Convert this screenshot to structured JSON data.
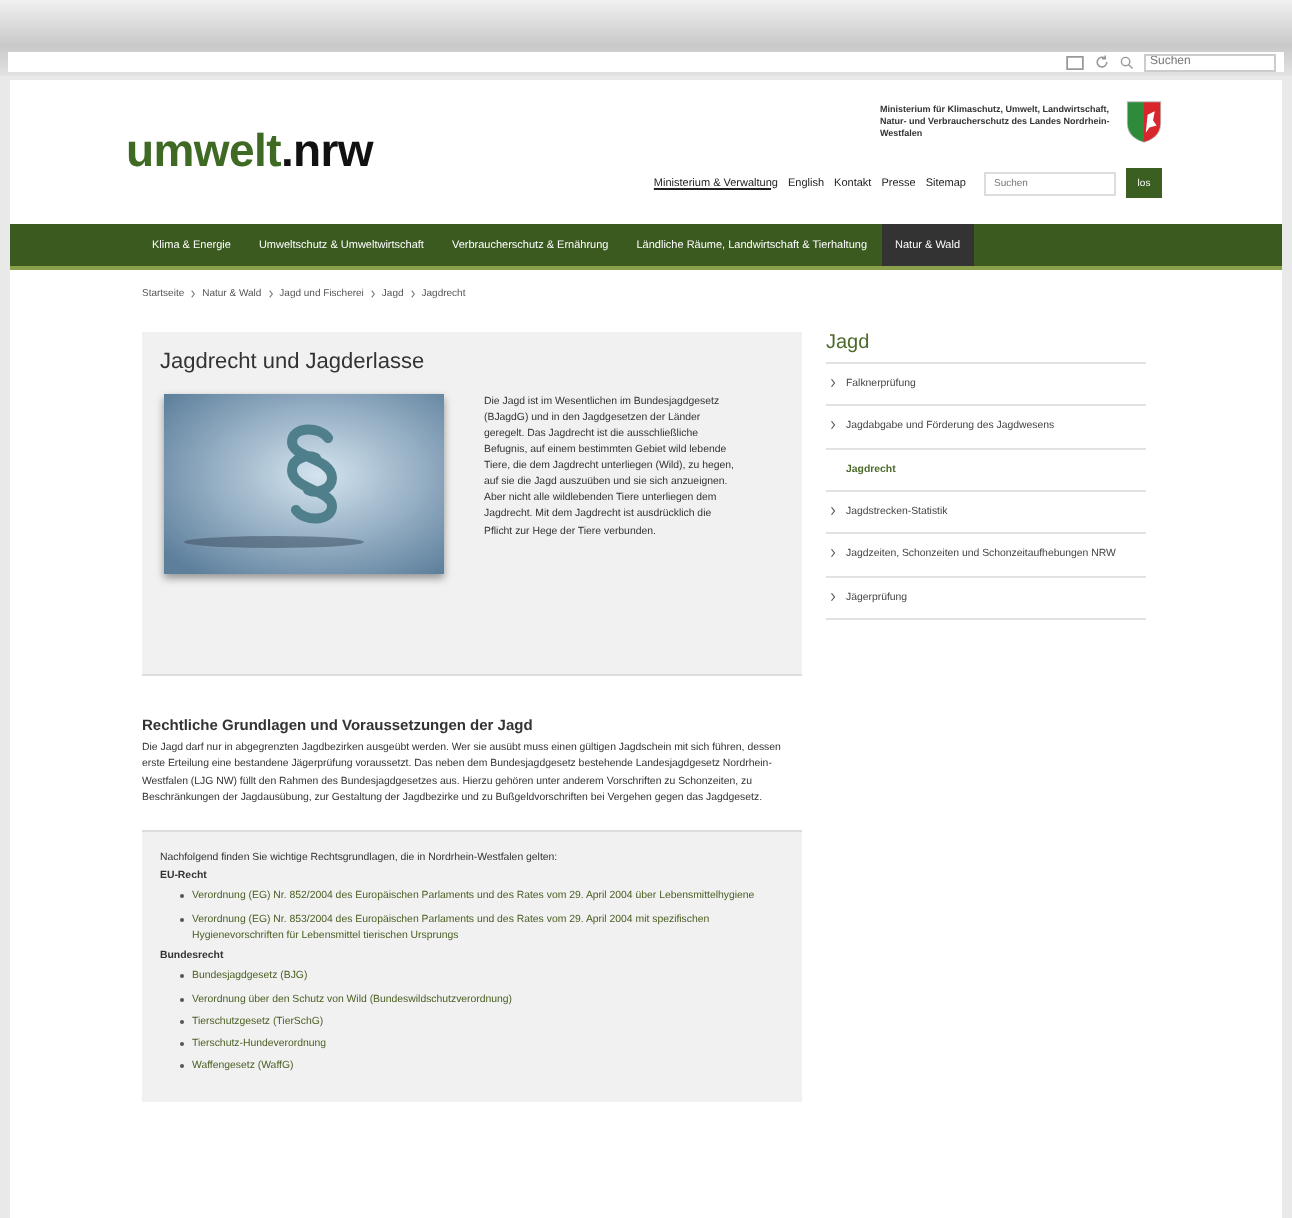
{
  "browser": {
    "search_placeholder": "Suchen"
  },
  "header": {
    "logo_main": "umwelt",
    "logo_suffix": ".nrw",
    "ministry": "Ministerium für Klimaschutz, Umwelt, Landwirtschaft, Natur- und Verbraucherschutz des Landes Nordrhein-Westfalen",
    "links": [
      {
        "label": "Ministerium & Verwaltung",
        "underlined": true
      },
      {
        "label": "English",
        "underlined": false
      },
      {
        "label": "Kontakt",
        "underlined": false
      },
      {
        "label": "Presse",
        "underlined": false
      },
      {
        "label": "Sitemap",
        "underlined": false
      }
    ],
    "search": {
      "placeholder": "Suchen",
      "button": "los"
    }
  },
  "nav": [
    {
      "label": "Klima & Energie",
      "selected": false
    },
    {
      "label": "Umweltschutz & Umweltwirtschaft",
      "selected": false
    },
    {
      "label": "Verbraucherschutz & Ernährung",
      "selected": false
    },
    {
      "label": "Ländliche Räume, Landwirtschaft & Tierhaltung",
      "selected": false
    },
    {
      "label": "Natur & Wald",
      "selected": true
    }
  ],
  "breadcrumb": [
    "Startseite",
    "Natur & Wald",
    "Jagd und Fischerei",
    "Jagd",
    "Jagdrecht"
  ],
  "teaser": {
    "title": "Jagdrecht und Jagderlasse",
    "text": "Die Jagd ist im Wesentlichen im Bundesjagdgesetz (BJagdG) und in den Jagdgesetzen der Länder geregelt. Das Jagdrecht ist die ausschließliche Befugnis, auf einem bestimmten Gebiet wild lebende Tiere, die dem Jagdrecht unterliegen (Wild), zu hegen, auf sie die Jagd auszuüben und sie sich anzueignen. Aber nicht alle wildlebenden Tiere unterliegen dem Jagdrecht. Mit dem Jagdrecht ist ausdrücklich die Pflicht zur Hege der Tiere verbunden."
  },
  "section": {
    "title": "Rechtliche Grundlagen und Voraussetzungen der Jagd",
    "text": "Die Jagd darf nur in abgegrenzten Jagdbezirken ausgeübt werden. Wer sie ausübt muss einen gültigen Jagdschein mit sich führen, dessen erste Erteilung eine bestandene Jägerprüfung voraussetzt. Das neben dem Bundesjagdgesetz bestehende Landesjagdgesetz Nordrhein-Westfalen (LJG NW) füllt den Rahmen des Bundesjagdgesetzes aus. Hierzu gehören unter anderem Vorschriften zu Schonzeiten, zu Beschränkungen der Jagdausübung, zur Gestaltung der Jagdbezirke und zu Bußgeldvorschriften bei Vergehen gegen das Jagdgesetz."
  },
  "legal_box": {
    "intro": "Nachfolgend finden Sie wichtige Rechtsgrundlagen, die in Nordrhein-Westfalen gelten:",
    "groups": [
      {
        "title": "EU-Recht",
        "items": [
          "Verordnung (EG) Nr. 852/2004 des Europäischen Parlaments und des Rates vom 29. April 2004 über Lebensmittelhygiene",
          "Verordnung (EG) Nr. 853/2004 des Europäischen Parlaments und des Rates vom 29. April 2004 mit spezifischen Hygienevorschriften für Lebensmittel tierischen Ursprungs"
        ]
      },
      {
        "title": "Bundesrecht",
        "items": [
          "Bundesjagdgesetz (BJG)",
          "Verordnung über den Schutz von Wild (Bundeswildschutzverordnung)",
          "Tierschutzgesetz (TierSchG)",
          "Tierschutz-Hundeverordnung",
          "Waffengesetz (WaffG)"
        ]
      }
    ]
  },
  "sidebar": {
    "title": "Jagd",
    "items": [
      {
        "label": "Falknerprüfung",
        "selected": false
      },
      {
        "label": "Jagdabgabe und Förderung des Jagdwesens",
        "selected": false
      },
      {
        "label": "Jagdrecht",
        "selected": true
      },
      {
        "label": "Jagdstrecken-Statistik",
        "selected": false
      },
      {
        "label": "Jagdzeiten, Schonzeiten und Schonzeitaufhebungen NRW",
        "selected": false
      },
      {
        "label": "Jägerprüfung",
        "selected": false
      }
    ]
  }
}
